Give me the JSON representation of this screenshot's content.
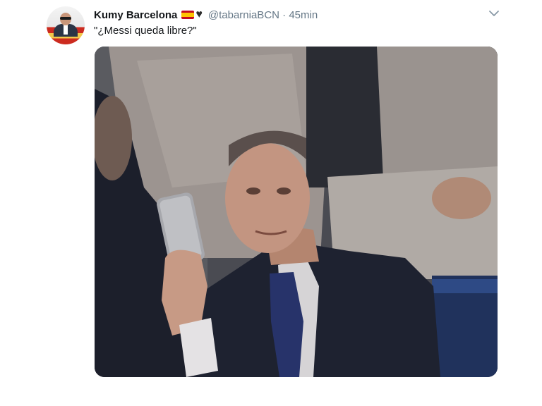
{
  "tweet": {
    "author_name": "Kumy Barcelona",
    "flag_icon": "spain-flag-icon",
    "heart_icon": "black-heart-icon",
    "handle": "@tabarniaBCN",
    "separator": "·",
    "time": "45min",
    "text": "\"¿Messi queda libre?\"",
    "media_alt": "video-still"
  },
  "colors": {
    "name": "#14171a",
    "secondary": "#657786",
    "accent": "#1da1f2"
  }
}
